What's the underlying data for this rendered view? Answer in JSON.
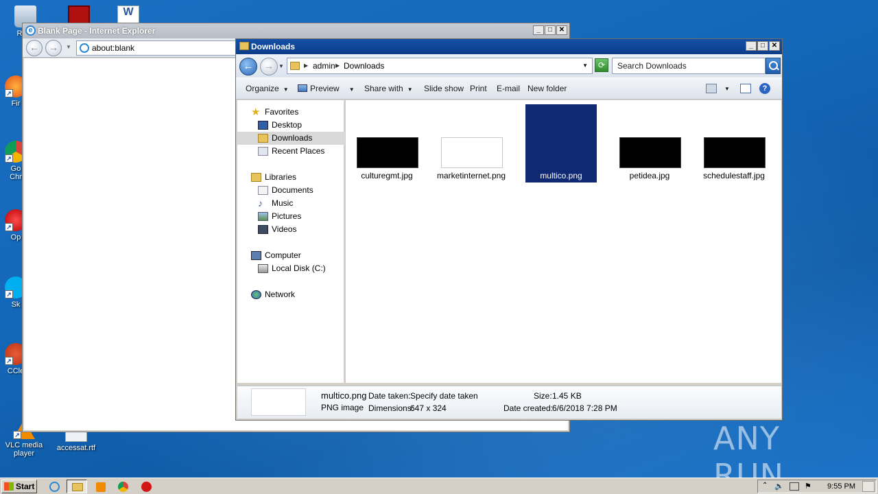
{
  "desktop": {
    "icons": [
      {
        "label": "Recy",
        "name": "recycle-bin"
      },
      {
        "label": "Fir",
        "name": "firefox"
      },
      {
        "label": "Go",
        "label2": "Chr",
        "name": "chrome"
      },
      {
        "label": "Op",
        "name": "opera"
      },
      {
        "label": "Sk",
        "name": "skype"
      },
      {
        "label": "CCle",
        "name": "ccleaner"
      },
      {
        "label": "VLC media",
        "label2": "player",
        "name": "vlc"
      },
      {
        "label": "accessat.rtf",
        "name": "rtf-file"
      }
    ]
  },
  "ie": {
    "title": "Blank Page - Internet Explorer",
    "address": "about:blank"
  },
  "explorer": {
    "title": "Downloads",
    "breadcrumb": [
      "admin",
      "Downloads"
    ],
    "search_placeholder": "Search Downloads",
    "toolbar": {
      "organize": "Organize",
      "preview": "Preview",
      "share_with": "Share with",
      "slide_show": "Slide show",
      "print": "Print",
      "email": "E-mail",
      "new_folder": "New folder"
    },
    "nav": {
      "favorites": "Favorites",
      "desktop": "Desktop",
      "downloads": "Downloads",
      "recent_places": "Recent Places",
      "libraries": "Libraries",
      "documents": "Documents",
      "music": "Music",
      "pictures": "Pictures",
      "videos": "Videos",
      "computer": "Computer",
      "local_disk": "Local Disk (C:)",
      "network": "Network"
    },
    "files": [
      {
        "name": "culturegmt.jpg",
        "thumb": "#000000",
        "selected": false
      },
      {
        "name": "marketinternet.png",
        "thumb": "#ffffff",
        "selected": false
      },
      {
        "name": "multico.png",
        "thumb": "#0f2a72",
        "selected": true
      },
      {
        "name": "petidea.jpg",
        "thumb": "#000000",
        "selected": false
      },
      {
        "name": "schedulestaff.jpg",
        "thumb": "#000000",
        "selected": false
      }
    ],
    "details": {
      "filename": "multico.png",
      "filetype": "PNG image",
      "date_taken_label": "Date taken:",
      "date_taken_value": "Specify date taken",
      "dimensions_label": "Dimensions:",
      "dimensions_value": "647 x 324",
      "size_label": "Size:",
      "size_value": "1.45 KB",
      "date_created_label": "Date created:",
      "date_created_value": "6/6/2018 7:28 PM"
    }
  },
  "taskbar": {
    "start": "Start",
    "clock": "9:55 PM"
  },
  "watermark": "ANY  RUN",
  "colors": {
    "selection": "#0f2a72",
    "title_active": "#1450a8"
  }
}
